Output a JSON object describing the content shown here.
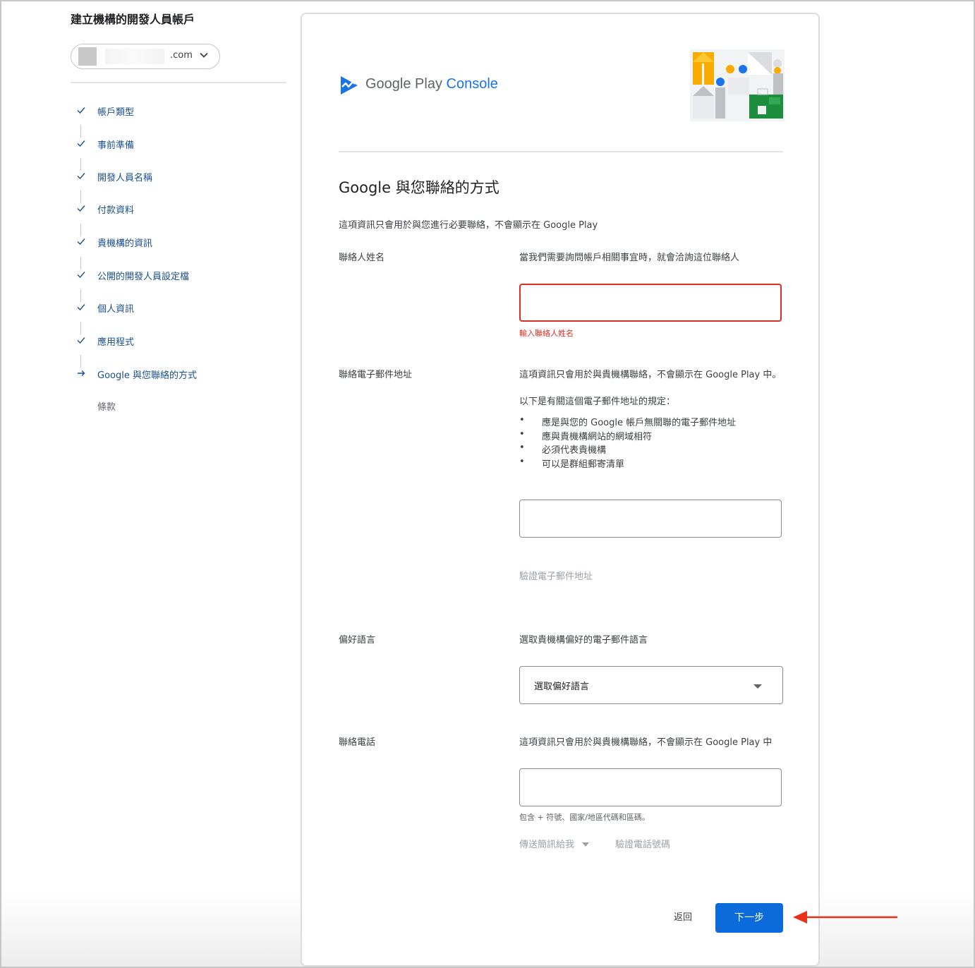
{
  "sidebar": {
    "title": "建立機構的開發人員帳戶",
    "account": {
      "domain_suffix": ".com"
    },
    "steps": [
      {
        "label": "帳戶類型",
        "state": "done"
      },
      {
        "label": "事前準備",
        "state": "done"
      },
      {
        "label": "開發人員名稱",
        "state": "done"
      },
      {
        "label": "付款資料",
        "state": "done"
      },
      {
        "label": "貴機構的資訊",
        "state": "done"
      },
      {
        "label": "公開的開發人員設定檔",
        "state": "done"
      },
      {
        "label": "個人資訊",
        "state": "done"
      },
      {
        "label": "應用程式",
        "state": "done"
      },
      {
        "label": "Google 與您聯絡的方式",
        "state": "current"
      },
      {
        "label": "條款",
        "state": "pending"
      }
    ]
  },
  "brand": {
    "name_part1": "Google Play",
    "name_part2": "Console"
  },
  "form": {
    "title": "Google 與您聯絡的方式",
    "subtitle": "這項資訊只會用於與您進行必要聯絡，不會顯示在 Google Play",
    "contact_name": {
      "label": "聯絡人姓名",
      "description": "當我們需要詢問帳戶相關事宜時，就會洽詢這位聯絡人",
      "value": "",
      "error": "輸入聯絡人姓名"
    },
    "contact_email": {
      "label": "聯絡電子郵件地址",
      "description": "這項資訊只會用於與貴機構聯絡，不會顯示在 Google Play 中。",
      "rules_intro": "以下是有關這個電子郵件地址的規定：",
      "rules": [
        "應是與您的 Google 帳戶無關聯的電子郵件地址",
        "應與貴機構網站的網域相符",
        "必須代表貴機構",
        "可以是群組郵寄清單"
      ],
      "bullet": "•",
      "value": "",
      "verify_label": "驗證電子郵件地址"
    },
    "preferred_language": {
      "label": "偏好語言",
      "description": "選取貴機構偏好的電子郵件語言",
      "selected": "選取偏好語言"
    },
    "contact_phone": {
      "label": "聯絡電話",
      "description": "這項資訊只會用於與貴機構聯絡，不會顯示在 Google Play 中",
      "value": "",
      "helper": "包含 + 符號、國家/地區代碼和區碼。",
      "send_sms_label": "傳送簡訊給我",
      "verify_label": "驗證電話號碼"
    }
  },
  "actions": {
    "back_label": "返回",
    "next_label": "下一步"
  },
  "colors": {
    "accent": "#0b6bdb",
    "error": "#d93025",
    "step_text": "#1a4f8b",
    "annotation": "#e8321b"
  }
}
